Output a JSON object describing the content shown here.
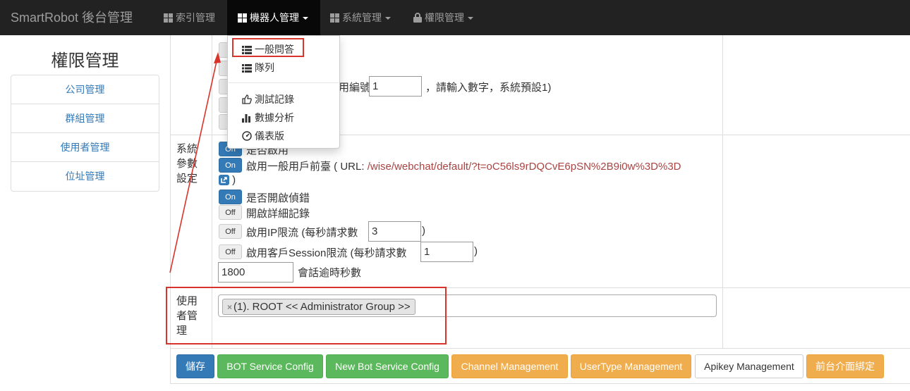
{
  "navbar": {
    "brand": "SmartRobot 後台管理",
    "items": [
      {
        "label": "索引管理",
        "icon": "th-large-icon"
      },
      {
        "label": "機器人管理",
        "icon": "th-large-icon",
        "active": true
      },
      {
        "label": "系統管理",
        "icon": "th-large-icon"
      },
      {
        "label": "權限管理",
        "icon": "lock-icon"
      }
    ]
  },
  "dropdown": {
    "items": [
      {
        "label": "一般問答",
        "icon": "list-icon"
      },
      {
        "label": "隊列",
        "icon": "list-icon"
      },
      {
        "label": "測試記錄",
        "icon": "thumbs-up-icon"
      },
      {
        "label": "數據分析",
        "icon": "bar-chart-icon"
      },
      {
        "label": "儀表版",
        "icon": "dashboard-icon"
      }
    ]
  },
  "sidebar": {
    "title": "權限管理",
    "items": [
      {
        "label": "公司管理"
      },
      {
        "label": "群組管理"
      },
      {
        "label": "使用者管理"
      },
      {
        "label": "位址管理"
      }
    ]
  },
  "partial_row": {
    "suffix_text": "用編號",
    "number_value": "1",
    "note": "，請輸入數字，系統預設1)"
  },
  "system_settings": {
    "label": "系統參數設定",
    "label_lines": [
      "系統",
      "參數",
      "設定"
    ],
    "enable_label": "是否啟用",
    "frontend_label": "啟用一般用戶前臺 ( URL: ",
    "frontend_url": "/wise/webchat/default/?t=oC56ls9rDQCvE6pSN%2B9i0w%3D%3D",
    "frontend_close": ")",
    "debug_label": "是否開啟偵錯",
    "detail_log_label": "開啟詳細記錄",
    "ip_limit_label": "啟用IP限流 (每秒請求數",
    "ip_limit_value": "3",
    "session_limit_label": "啟用客戶Session限流 (每秒請求數",
    "session_limit_value": "1",
    "close_paren": ")",
    "timeout_value": "1800",
    "timeout_label": "會話逾時秒數",
    "toggle_on": "On",
    "toggle_off": "Off"
  },
  "user_management": {
    "label_lines": [
      "使用",
      "者管",
      "理"
    ],
    "tag_remove": "×",
    "tag": "(1). ROOT << Administrator Group >>"
  },
  "buttons": [
    {
      "label": "儲存",
      "style": "primary"
    },
    {
      "label": "BOT Service Config",
      "style": "success"
    },
    {
      "label": "New Bot Service Config",
      "style": "success"
    },
    {
      "label": "Channel Management",
      "style": "warning"
    },
    {
      "label": "UserType Management",
      "style": "warning"
    },
    {
      "label": "Apikey Management",
      "style": "default"
    },
    {
      "label": "前台介面綁定",
      "style": "warning"
    }
  ],
  "colors": {
    "navbar": "#222222",
    "primary": "#337ab7",
    "success": "#5cb85c",
    "warning": "#f0ad4e",
    "annotation": "#d9342b",
    "url": "#a94442"
  }
}
